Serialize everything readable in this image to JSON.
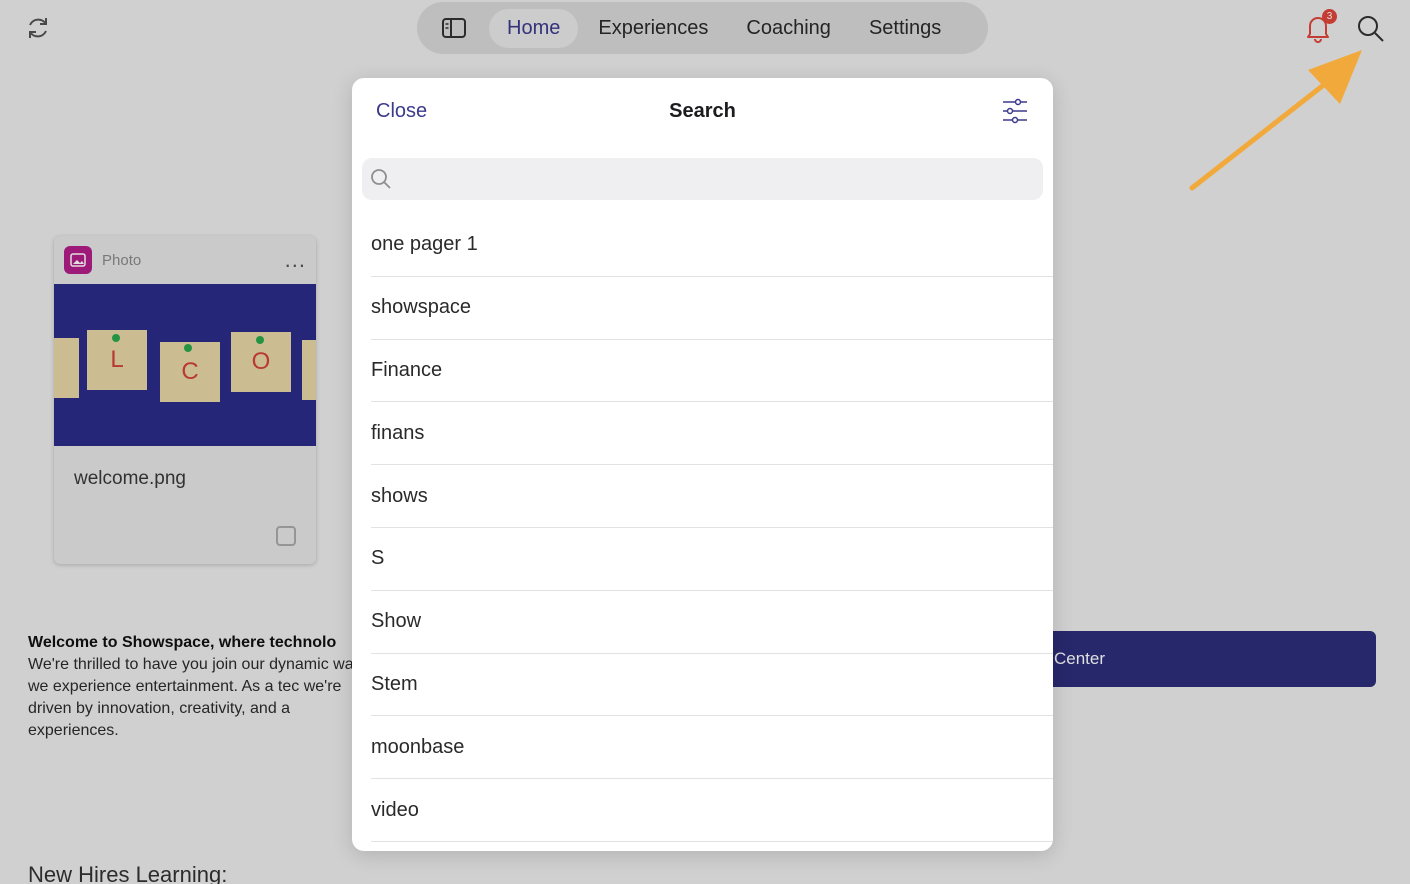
{
  "nav": {
    "tabs": [
      {
        "label": "Home",
        "active": true
      },
      {
        "label": "Experiences",
        "active": false
      },
      {
        "label": "Coaching",
        "active": false
      },
      {
        "label": "Settings",
        "active": false
      }
    ],
    "notification_count": "3"
  },
  "card": {
    "type_label": "Photo",
    "more_label": "...",
    "file_name": "welcome.png",
    "image_letters": [
      "L",
      "C",
      "O"
    ]
  },
  "welcome": {
    "heading": "Welcome to Showspace, where technolo",
    "body": "We're thrilled to have you join our dynamic way we experience entertainment. As a tec we're driven by innovation, creativity, and a experiences."
  },
  "section_title": "New Hires Learning:",
  "help_button_label": "Center",
  "search_modal": {
    "close_label": "Close",
    "title": "Search",
    "search_value": "",
    "results": [
      "one pager 1",
      "showspace",
      "Finance",
      "finans",
      "shows",
      "S",
      "Show",
      "Stem",
      "moonbase",
      "video"
    ]
  },
  "colors": {
    "accent": "#3b3a8c",
    "badge": "#e0463b",
    "arrow": "#f2a93b",
    "button_bg": "#2d2d7c"
  },
  "icons": [
    "refresh-icon",
    "sidebar-toggle-icon",
    "bell-icon",
    "search-icon",
    "filter-icon",
    "photo-icon"
  ]
}
